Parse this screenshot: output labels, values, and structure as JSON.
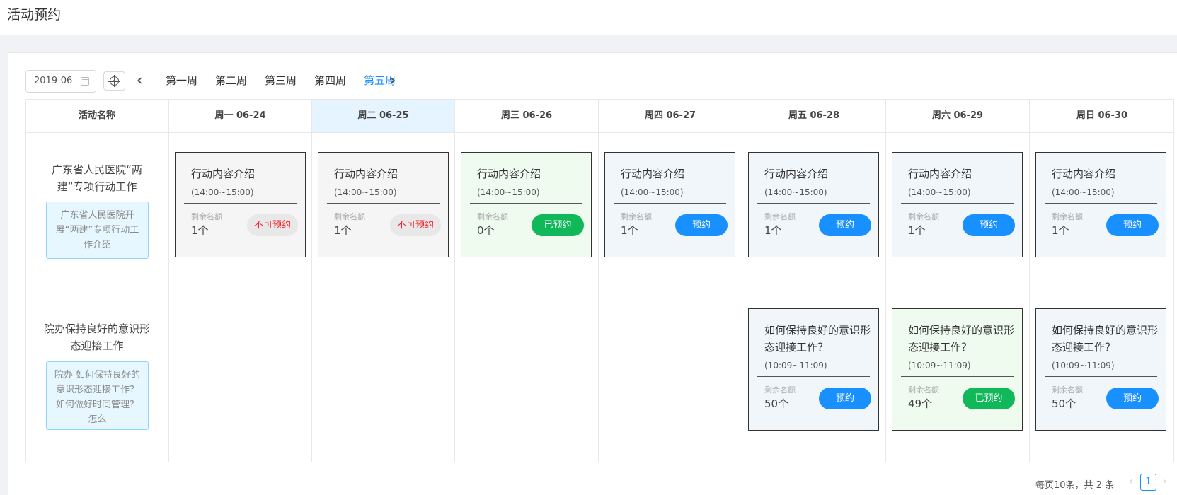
{
  "page": {
    "title": "活动预约"
  },
  "toolbar": {
    "month": "2019-06",
    "prev_icon": "chevron-left-icon",
    "next_icon": "chevron-right-icon",
    "weeks": [
      "第一周",
      "第二周",
      "第三周",
      "第四周",
      "第五周"
    ],
    "active_week": "第五周"
  },
  "table": {
    "name_header": "活动名称",
    "days": [
      "周一 06-24",
      "周二 06-25",
      "周三 06-26",
      "周四 06-27",
      "周五 06-28",
      "周六 06-29",
      "周日 06-30"
    ],
    "highlighted_day": "周二 06-25",
    "rows": [
      {
        "name": "广东省人民医院“两建”专项行动工作",
        "description": "广东省人民医院开展“两建”专项行动工作介绍",
        "slots": [
          {
            "title": "行动内容介绍",
            "time": "(14:00~15:00)",
            "remaining_label": "剩余名额",
            "remaining": "1个",
            "button": "不可预约",
            "state": "disabled"
          },
          {
            "title": "行动内容介绍",
            "time": "(14:00~15:00)",
            "remaining_label": "剩余名额",
            "remaining": "1个",
            "button": "不可预约",
            "state": "disabled"
          },
          {
            "title": "行动内容介绍",
            "time": "(14:00~15:00)",
            "remaining_label": "剩余名额",
            "remaining": "0个",
            "button": "已预约",
            "state": "booked"
          },
          {
            "title": "行动内容介绍",
            "time": "(14:00~15:00)",
            "remaining_label": "剩余名额",
            "remaining": "1个",
            "button": "预约",
            "state": "open"
          },
          {
            "title": "行动内容介绍",
            "time": "(14:00~15:00)",
            "remaining_label": "剩余名额",
            "remaining": "1个",
            "button": "预约",
            "state": "open"
          },
          {
            "title": "行动内容介绍",
            "time": "(14:00~15:00)",
            "remaining_label": "剩余名额",
            "remaining": "1个",
            "button": "预约",
            "state": "open"
          },
          {
            "title": "行动内容介绍",
            "time": "(14:00~15:00)",
            "remaining_label": "剩余名额",
            "remaining": "1个",
            "button": "预约",
            "state": "open"
          }
        ]
      },
      {
        "name": "院办保持良好的意识形态迎接工作",
        "description": "院办 如何保持良好的意识形态迎接工作？ 如何做好时间管理？ 怎么",
        "slots": [
          null,
          null,
          null,
          null,
          {
            "title": "如何保持良好的意识形态迎接工作？",
            "time": "(10:09~11:09)",
            "remaining_label": "剩余名额",
            "remaining": "50个",
            "button": "预约",
            "state": "open"
          },
          {
            "title": "如何保持良好的意识形态迎接工作？",
            "time": "(10:09~11:09)",
            "remaining_label": "剩余名额",
            "remaining": "49个",
            "button": "已预约",
            "state": "booked"
          },
          {
            "title": "如何保持良好的意识形态迎接工作？",
            "time": "(10:09~11:09)",
            "remaining_label": "剩余名额",
            "remaining": "50个",
            "button": "预约",
            "state": "open"
          }
        ]
      }
    ]
  },
  "pagination": {
    "info": "每页10条，共 2 条",
    "current_page": "1",
    "prev": "‹",
    "next": "›"
  },
  "colors": {
    "accent": "#1890ff",
    "booked": "#10b85a",
    "disabled_text": "#f5222d",
    "highlight_header": "#e6f4ff"
  }
}
